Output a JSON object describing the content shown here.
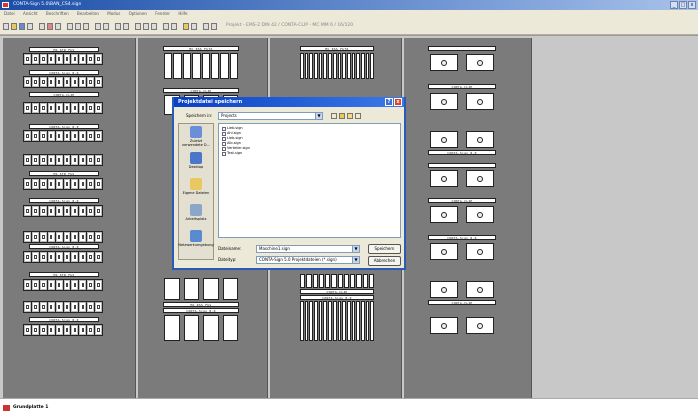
{
  "window": {
    "title": "CONTA-Sign 5.0\\BAN_CS4.sign",
    "controls": [
      "_",
      "□",
      "x"
    ]
  },
  "menu": [
    "Datei",
    "Ansicht",
    "Beschriften",
    "Bearbeiten",
    "Modus",
    "Optionen",
    "Fenster",
    "Hilfe"
  ],
  "toolbar": {
    "path": "Projekt - EMS-2 DIN 42 / CONTA-CLIP - MC MM 6 / 16/120"
  },
  "canvas": {
    "labels": {
      "mstr": "MS STR FkS",
      "clip": "CONTA-CLIP",
      "sign": "CONTA-Sign 8.0",
      "mcclip": "MC CLIP KS",
      "mcfk": "MC KSS Fk76",
      "mcfk2": "MC KSS FkS"
    }
  },
  "dialog": {
    "title": "Projektdatei speichern",
    "save_in_label": "Speichern in:",
    "folder": "Projects",
    "places": [
      {
        "label": "Zuletzt verwendete D...",
        "icon": "recent-documents-icon"
      },
      {
        "label": "Desktop",
        "icon": "desktop-icon"
      },
      {
        "label": "Eigene Dateien",
        "icon": "my-documents-icon"
      },
      {
        "label": "Arbeitsplatz",
        "icon": "my-computer-icon"
      },
      {
        "label": "Netzwerkumgebung",
        "icon": "network-places-icon"
      }
    ],
    "files": [
      "Lieb.sign",
      "Ahl.sign",
      "Lieb.sign",
      "Alb.sign",
      "Verteiler.sign",
      "Test.sign"
    ],
    "filename_label": "Dateiname:",
    "filename_value": "Maschine1.sign",
    "filetype_label": "Dateityp:",
    "filetype_value": "CONTA-Sign 5.0 Projektdateien (*.sign)",
    "save_button": "Speichern",
    "cancel_button": "Abbrechen"
  },
  "statusbar": {
    "page": "Grundplatte 1"
  }
}
